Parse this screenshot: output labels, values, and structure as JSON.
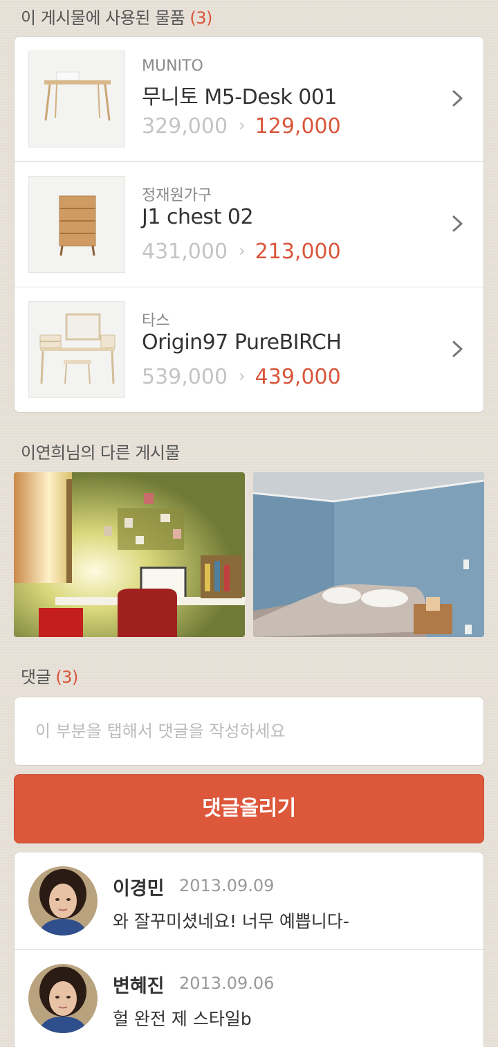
{
  "used_items": {
    "title": "이 게시물에 사용된 물품",
    "count": "(3)",
    "items": [
      {
        "brand": "MUNITO",
        "name": "무니토 M5-Desk 001",
        "old_price": "329,000",
        "new_price": "129,000"
      },
      {
        "brand": "정재원가구",
        "name": "J1 chest 02",
        "old_price": "431,000",
        "new_price": "213,000"
      },
      {
        "brand": "타스",
        "name": "Origin97 PureBIRCH",
        "old_price": "539,000",
        "new_price": "439,000"
      }
    ]
  },
  "other_posts": {
    "title": "이연희님의 다른 게시물"
  },
  "comments": {
    "title": "댓글",
    "count": "(3)",
    "input_placeholder": "이 부분을 탭해서 댓글을 작성하세요",
    "submit_label": "댓글올리기",
    "list": [
      {
        "name": "이경민",
        "date": "2013.09.09",
        "text": "와 잘꾸미셨네요! 너무 예쁩니다-"
      },
      {
        "name": "변혜진",
        "date": "2013.09.06",
        "text": "헐 완전 제 스타일b"
      }
    ]
  },
  "colors": {
    "accent": "#dd573b",
    "background": "#e8e1d8"
  }
}
